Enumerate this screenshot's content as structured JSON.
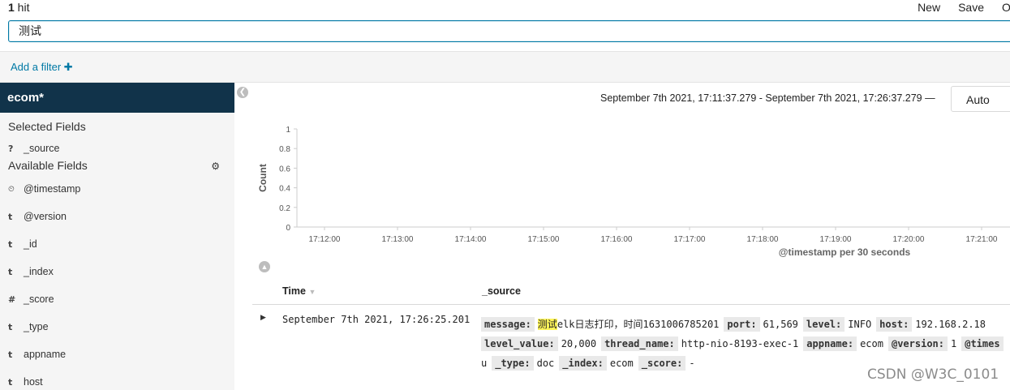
{
  "topbar": {
    "hit_count": "1",
    "hit_label": " hit",
    "actions": {
      "new": "New",
      "save": "Save",
      "open": "O"
    }
  },
  "query": {
    "value": "测试"
  },
  "filters": {
    "add_filter_label": "Add a filter",
    "add_filter_plus": "✚"
  },
  "sidebar": {
    "index_pattern": "ecom*",
    "selected_title": "Selected Fields",
    "selected_fields": [
      {
        "type": "?",
        "name": "_source"
      }
    ],
    "available_title": "Available Fields",
    "available_fields": [
      {
        "type": "⏲",
        "name": "@timestamp"
      },
      {
        "type": "t",
        "name": "@version"
      },
      {
        "type": "t",
        "name": "_id"
      },
      {
        "type": "t",
        "name": "_index"
      },
      {
        "type": "#",
        "name": "_score"
      },
      {
        "type": "t",
        "name": "_type"
      },
      {
        "type": "t",
        "name": "appname"
      },
      {
        "type": "t",
        "name": "host"
      }
    ]
  },
  "main": {
    "time_range": "September 7th 2021, 17:11:37.279 - September 7th 2021, 17:26:37.279 —",
    "interval": "Auto"
  },
  "chart_data": {
    "type": "bar",
    "categories": [
      "17:12:00",
      "17:13:00",
      "17:14:00",
      "17:15:00",
      "17:16:00",
      "17:17:00",
      "17:18:00",
      "17:19:00",
      "17:20:00",
      "17:21:00"
    ],
    "values": [
      0,
      0,
      0,
      0,
      0,
      0,
      0,
      0,
      0,
      0
    ],
    "yticks": [
      "0",
      "0.2",
      "0.4",
      "0.6",
      "0.8",
      "1"
    ],
    "ylim": [
      0,
      1
    ],
    "xlabel": "@timestamp per 30 seconds",
    "ylabel": "Count"
  },
  "table": {
    "col_time": "Time",
    "col_source": "_source",
    "rows": [
      {
        "time": "September 7th 2021, 17:26:25.201",
        "source_lines": [
          [
            [
              "message:",
              "测试",
              "elk日志打印，时间1631006785201"
            ],
            [
              "port:",
              "61,569"
            ],
            [
              "level:",
              "INFO"
            ],
            [
              "host:",
              "192.168.2.18"
            ]
          ],
          [
            [
              "level_value:",
              "20,000"
            ],
            [
              "thread_name:",
              "http-nio-8193-exec-1"
            ],
            [
              "appname:",
              "ecom"
            ],
            [
              "@version:",
              "1"
            ],
            [
              "@times",
              ""
            ]
          ],
          [
            [
              "",
              "u"
            ],
            [
              "_type:",
              "doc"
            ],
            [
              "_index:",
              "ecom"
            ],
            [
              "_score:",
              "-"
            ]
          ]
        ]
      }
    ]
  },
  "watermark": "CSDN @W3C_0101"
}
